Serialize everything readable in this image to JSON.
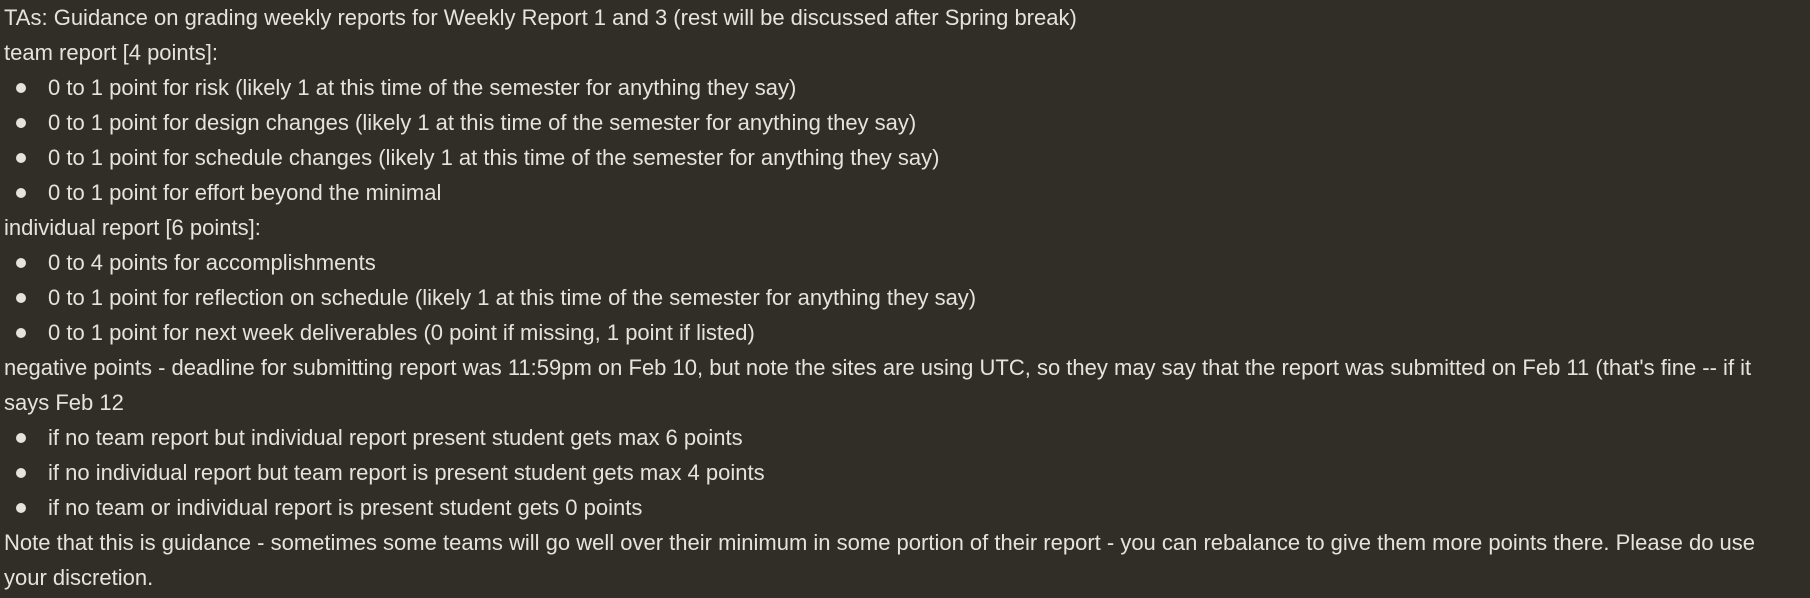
{
  "message": {
    "intro": "TAs: Guidance on grading weekly reports for Weekly Report 1 and 3 (rest will be discussed after Spring break)",
    "team_heading": "team report [4 points]:",
    "team_items": [
      "0 to 1 point for risk (likely 1 at this time of the semester for anything they say)",
      "0 to 1 point for design changes (likely 1 at this time of the semester for anything they say)",
      "0 to 1 point for schedule changes (likely 1 at this time of the semester for anything they say)",
      "0 to 1 point for effort beyond the minimal"
    ],
    "individual_heading": "individual report [6 points]:",
    "individual_items": [
      "0 to 4 points for accomplishments",
      "0 to 1 point for reflection on schedule (likely 1 at this time of the semester for anything they say)",
      "0 to 1 point for next week deliverables (0 point if missing, 1 point if listed)"
    ],
    "negative_heading": "negative points - deadline for submitting report was 11:59pm on Feb 10, but note the sites are using UTC, so they may say that the report was submitted on Feb 11 (that's fine -- if it says Feb 12",
    "negative_items": [
      "if no team report but individual report present student gets max 6 points",
      "if no individual report but team report is present student gets max 4 points",
      "if no team or individual report is present student gets 0 points"
    ],
    "closing": "Note that this is guidance - sometimes some teams will go well over their minimum in some portion of their report - you can rebalance to give them more points there. Please do use your discretion."
  },
  "colors": {
    "background": "#312e28",
    "text": "#e6e3dc"
  }
}
